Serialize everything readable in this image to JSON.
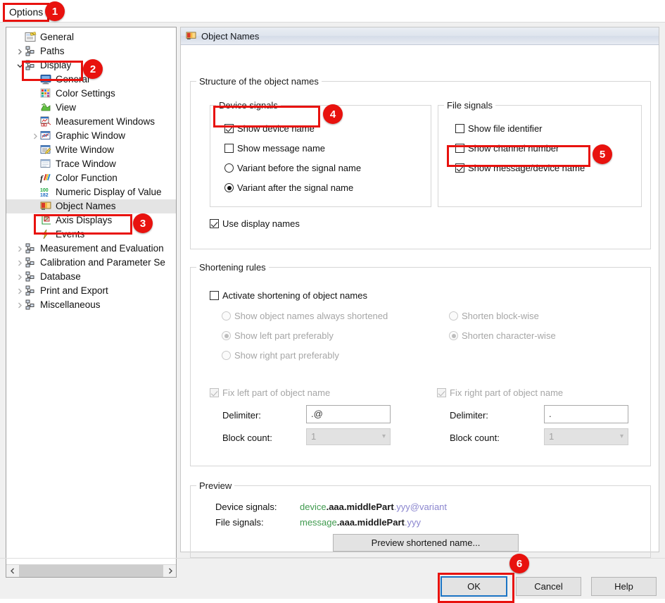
{
  "window": {
    "options_label": "Options",
    "panel_title": "Object Names"
  },
  "badges": [
    "1",
    "2",
    "3",
    "4",
    "5",
    "6"
  ],
  "tree": {
    "items": [
      {
        "label": "General",
        "icon": "general-page-icon",
        "indent": 1,
        "chevron": "none",
        "selected": false
      },
      {
        "label": "Paths",
        "icon": "branch-icon",
        "indent": 0,
        "chevron": "collapsed",
        "selected": false
      },
      {
        "label": "Display",
        "icon": "branch-icon",
        "indent": 0,
        "chevron": "expanded",
        "selected": false
      },
      {
        "label": "General",
        "icon": "monitor-icon",
        "indent": 2,
        "chevron": "none",
        "selected": false
      },
      {
        "label": "Color Settings",
        "icon": "color-palette-icon",
        "indent": 2,
        "chevron": "none",
        "selected": false
      },
      {
        "label": "View",
        "icon": "view-icon",
        "indent": 2,
        "chevron": "none",
        "selected": false
      },
      {
        "label": "Measurement Windows",
        "icon": "measurement-windows-icon",
        "indent": 2,
        "chevron": "none",
        "selected": false
      },
      {
        "label": "Graphic Window",
        "icon": "graphic-window-icon",
        "indent": 1,
        "chevron": "collapsed",
        "selected": false
      },
      {
        "label": "Write Window",
        "icon": "write-window-icon",
        "indent": 2,
        "chevron": "none",
        "selected": false
      },
      {
        "label": "Trace Window",
        "icon": "trace-window-icon",
        "indent": 2,
        "chevron": "none",
        "selected": false
      },
      {
        "label": "Color Function",
        "icon": "color-function-icon",
        "indent": 2,
        "chevron": "none",
        "selected": false
      },
      {
        "label": "Numeric Display of Value",
        "icon": "numeric-display-icon",
        "indent": 2,
        "chevron": "none",
        "selected": false
      },
      {
        "label": "Object Names",
        "icon": "object-names-icon",
        "indent": 2,
        "chevron": "none",
        "selected": true
      },
      {
        "label": "Axis Displays",
        "icon": "axis-displays-icon",
        "indent": 2,
        "chevron": "none",
        "selected": false
      },
      {
        "label": "Events",
        "icon": "events-icon",
        "indent": 2,
        "chevron": "none",
        "selected": false
      },
      {
        "label": "Measurement and Evaluation",
        "icon": "branch-icon",
        "indent": 0,
        "chevron": "collapsed",
        "selected": false
      },
      {
        "label": "Calibration and Parameter Se",
        "icon": "branch-icon",
        "indent": 0,
        "chevron": "collapsed",
        "selected": false
      },
      {
        "label": "Database",
        "icon": "branch-icon",
        "indent": 0,
        "chevron": "collapsed",
        "selected": false
      },
      {
        "label": "Print and Export",
        "icon": "branch-icon",
        "indent": 0,
        "chevron": "collapsed",
        "selected": false
      },
      {
        "label": "Miscellaneous",
        "icon": "branch-icon",
        "indent": 0,
        "chevron": "collapsed",
        "selected": false
      }
    ]
  },
  "structure_group": {
    "title": "Structure of the object names",
    "device_signals": {
      "title": "Device signals",
      "show_device_name": {
        "label": "Show device name",
        "checked": true
      },
      "show_message_name": {
        "label": "Show message name",
        "checked": false
      },
      "variant_before": {
        "label": "Variant before the signal name",
        "selected": false
      },
      "variant_after": {
        "label": "Variant after the signal name",
        "selected": true
      }
    },
    "file_signals": {
      "title": "File signals",
      "show_file_identifier": {
        "label": "Show file identifier",
        "checked": false
      },
      "show_channel_number": {
        "label": "Show channel number",
        "checked": false
      },
      "show_message_device_name": {
        "label": "Show message/device name",
        "checked": true
      }
    },
    "use_display_names": {
      "label": "Use display names",
      "checked": true
    }
  },
  "shortening_group": {
    "title": "Shortening rules",
    "activate": {
      "label": "Activate shortening of object names",
      "checked": false
    },
    "left_options": [
      {
        "label": "Show object names always shortened",
        "selected": false
      },
      {
        "label": "Show left part preferably",
        "selected": true
      },
      {
        "label": "Show right part preferably",
        "selected": false
      }
    ],
    "right_options": [
      {
        "label": "Shorten block-wise",
        "selected": false
      },
      {
        "label": "Shorten character-wise",
        "selected": true
      }
    ],
    "fix_left": {
      "label": "Fix left part of object name",
      "checked": true
    },
    "fix_right": {
      "label": "Fix right part of object name",
      "checked": true
    },
    "left_delimiter": {
      "label": "Delimiter:",
      "value": ".@"
    },
    "right_delimiter": {
      "label": "Delimiter:",
      "value": "."
    },
    "left_block_count": {
      "label": "Block count:",
      "value": "1"
    },
    "right_block_count": {
      "label": "Block count:",
      "value": "1"
    }
  },
  "preview_group": {
    "title": "Preview",
    "device_signals_label": "Device signals:",
    "device_signals_value": {
      "prefix": "device",
      "middle": ".aaa.middlePart",
      "suffix": ".yyy@variant"
    },
    "file_signals_label": "File signals:",
    "file_signals_value": {
      "prefix": "message",
      "middle": ".aaa.middlePart",
      "suffix": ".yyy"
    },
    "preview_button": "Preview shortened name..."
  },
  "footer": {
    "ok": "OK",
    "cancel": "Cancel",
    "help": "Help"
  },
  "colors": {
    "accent_red": "#e8120e",
    "preview_green": "#3f9a4e",
    "preview_purple": "#8b86cf",
    "focus_blue": "#1b74c4"
  }
}
